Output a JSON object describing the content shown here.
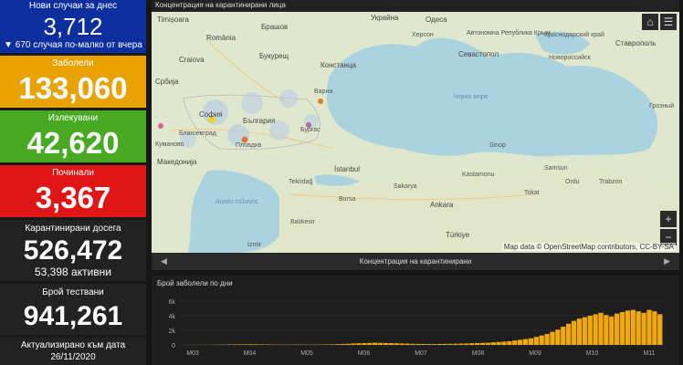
{
  "stats": {
    "new_cases": {
      "label": "Нови случаи за днес",
      "value": "3,712",
      "delta": "▼ 670 случая по-малко от вчера"
    },
    "sick": {
      "label": "Заболели",
      "value": "133,060"
    },
    "healed": {
      "label": "Излекувани",
      "value": "42,620"
    },
    "dead": {
      "label": "Починали",
      "value": "3,367"
    },
    "quarantined": {
      "label": "Карантинирани досега",
      "value": "526,472",
      "active": "53,398 активни"
    },
    "tested": {
      "label": "Брой тествани",
      "value": "941,261"
    },
    "updated": {
      "label": "Актуализирано към дата",
      "value": "26/11/2020"
    }
  },
  "map": {
    "title": "Концентрация на карантинирани лица",
    "nav_title": "Концентрация на карантинирани",
    "attribution": "Map data © OpenStreetMap contributors, CC-BY-SA",
    "zoom_in": "+",
    "zoom_out": "−",
    "home_icon": "⌂",
    "list_icon": "☰",
    "labels": {
      "timisoara": "Timișoara",
      "brasov": "Брашов",
      "ukraine": "Украйна",
      "odessa": "Одеса",
      "crimea": "Автономна Република Крым",
      "kherson": "Херсон",
      "craiova": "Craiova",
      "bucuresti": "Букурещ",
      "constanta": "Констанца",
      "sevastopol": "Севастопол",
      "krasnodar": "Краснодарский край",
      "stavropol": "Ставрополь",
      "novorossiysk": "Новороссийск",
      "serbia": "Србија",
      "romania": "România",
      "sofia": "София",
      "bulgaria": "България",
      "varna": "Варна",
      "burgas": "Бургас",
      "plovdiv": "Пловдив",
      "blagoevgrad": "Благоевград",
      "makedonija": "Македонија",
      "kumanovo": "Куманово",
      "istanbul": "İstanbul",
      "tekirdag": "Tekirdağ",
      "sakarya": "Sakarya",
      "bursa": "Bursa",
      "ankara": "Ankara",
      "balikesir": "Balıkesir",
      "turkiye": "Türkiye",
      "samsun": "Samsun",
      "ordu": "Ordu",
      "trabzon": "Trabzon",
      "tokat": "Tokat",
      "sinop": "Sinop",
      "kastamonu": "Kastamonu",
      "izmir": "İzmir",
      "grozny": "Грозный",
      "black_sea": "Черно море",
      "aegean": "Αιγαίο πέλαγος"
    }
  },
  "chart_data": {
    "type": "bar",
    "title": "Брой заболели по дни",
    "categories": [
      "M03",
      "M04",
      "M05",
      "M06",
      "M07",
      "M08",
      "M09",
      "M10",
      "M11"
    ],
    "yticks": [
      "0",
      "2k",
      "4k",
      "6k"
    ],
    "ylim": [
      0,
      6000
    ],
    "values": [
      0,
      5,
      10,
      15,
      20,
      20,
      30,
      40,
      50,
      60,
      70,
      70,
      80,
      90,
      80,
      70,
      60,
      50,
      40,
      40,
      40,
      50,
      50,
      40,
      40,
      40,
      50,
      60,
      80,
      100,
      120,
      150,
      200,
      230,
      250,
      270,
      300,
      280,
      260,
      250,
      230,
      200,
      180,
      150,
      140,
      130,
      120,
      120,
      130,
      140,
      150,
      160,
      180,
      200,
      230,
      250,
      280,
      300,
      350,
      400,
      450,
      500,
      600,
      700,
      800,
      900,
      1100,
      1300,
      1500,
      1800,
      2100,
      2500,
      2900,
      3300,
      3600,
      3800,
      4000,
      4200,
      4400,
      4100,
      3900,
      4300,
      4500,
      4700,
      4800,
      4600,
      4400,
      4800,
      4600,
      4200
    ],
    "color": "#f0a80e"
  }
}
